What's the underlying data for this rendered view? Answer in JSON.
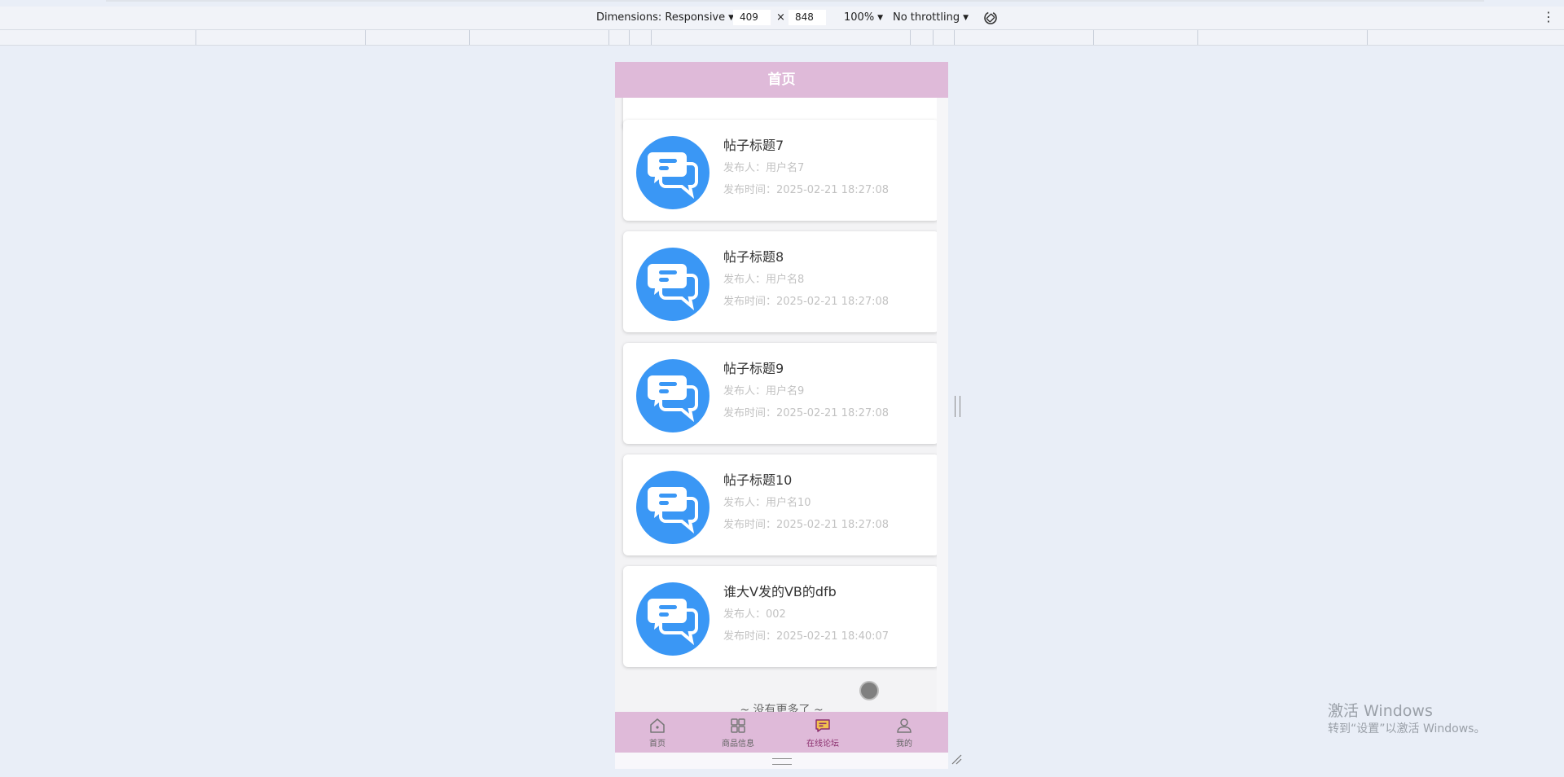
{
  "devtools": {
    "dimensions_label": "Dimensions: Responsive",
    "width_value": "409",
    "times": "×",
    "height_value": "848",
    "zoom": "100%",
    "throttling": "No throttling"
  },
  "app": {
    "header_title": "首页",
    "posts": [
      {
        "title": "帖子标题7",
        "author": "发布人：用户名7",
        "time": "发布时间：2025-02-21 18:27:08"
      },
      {
        "title": "帖子标题8",
        "author": "发布人：用户名8",
        "time": "发布时间：2025-02-21 18:27:08"
      },
      {
        "title": "帖子标题9",
        "author": "发布人：用户名9",
        "time": "发布时间：2025-02-21 18:27:08"
      },
      {
        "title": "帖子标题10",
        "author": "发布人：用户名10",
        "time": "发布时间：2025-02-21 18:27:08"
      },
      {
        "title": "谁大V发的VB的dfb",
        "author": "发布人：002",
        "time": "发布时间：2025-02-21 18:40:07"
      }
    ],
    "no_more": "~ 没有更多了 ~",
    "tabs": [
      {
        "label": "首页",
        "icon": "home-icon"
      },
      {
        "label": "商品信息",
        "icon": "grid-icon"
      },
      {
        "label": "在线论坛",
        "icon": "forum-icon"
      },
      {
        "label": "我的",
        "icon": "user-icon"
      }
    ],
    "active_tab": "在线论坛",
    "colors": {
      "header": "#dfbad9",
      "avatar": "#3a97f5",
      "active_tab": "#8b2f6e"
    }
  },
  "watermark": {
    "line1": "激活 Windows",
    "line2": "转到“设置”以激活 Windows。"
  }
}
